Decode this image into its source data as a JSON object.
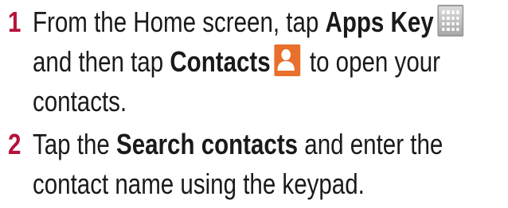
{
  "steps": [
    {
      "number": "1",
      "line1_text": "From the Home screen, tap ",
      "line1_bold": "Apps Key",
      "line1_icon": "apps-grid-icon",
      "line2_text": "and then tap ",
      "line2_bold": "Contacts",
      "line2_icon": "contacts-person-icon",
      "line2_after": " to open your",
      "line3_text": "contacts."
    },
    {
      "number": "2",
      "line1_text": "Tap the ",
      "line1_bold": "Search contacts",
      "line1_after": " and enter the",
      "line2_text": "contact name using the keypad."
    }
  ],
  "colors": {
    "step_number": "#b5123a",
    "text": "#1a1a1a",
    "contacts_icon": "#e8702c"
  }
}
